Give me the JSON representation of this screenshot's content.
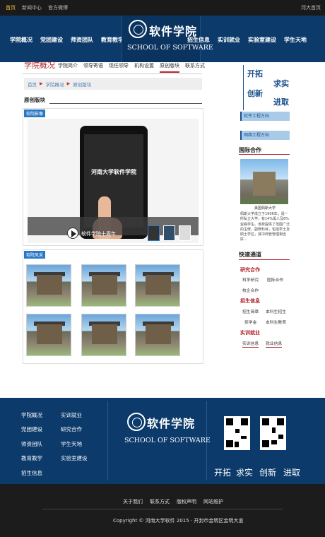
{
  "topbar": {
    "links": [
      "首页",
      "新闻中心",
      "官方微博"
    ],
    "right_link": "河大首页"
  },
  "header": {
    "nav_left": [
      "学院概况",
      "党团建设",
      "师资团队",
      "教育教学"
    ],
    "nav_right": [
      "招生信息",
      "实训就业",
      "实验室建设",
      "学生天地"
    ],
    "logo_cn": "软件学院",
    "logo_en": "SCHOOL OF SOFTWARE"
  },
  "subnav": {
    "section_title": "学院概况",
    "items": [
      "学院简介",
      "领导寄语",
      "现任领导",
      "机构设置",
      "原创版块",
      "联系方式"
    ],
    "active_index": 4
  },
  "breadcrumb": [
    "首页",
    "学院概况",
    "原创版块"
  ],
  "block_title": "原创版块",
  "video_panel": {
    "tag": "软院影像",
    "tablet_title": "河南大学软件学院",
    "caption": "软件学院十周年"
  },
  "photo_panel": {
    "tag": "软院风采"
  },
  "sidebar": {
    "slogan": [
      "开拓",
      "求实",
      "创新",
      "进取"
    ],
    "links": [
      "软件工程方向",
      "网络工程方向"
    ],
    "intl_title": "国际合作",
    "photo_caption": "美国佩斯大学",
    "intl_text": "佩斯大学成立于1906年，是一所私立大学，有14%黑人及8%亚裔学生。该校提供了范围广泛的主修。副修科目，包括学士及硕士学位，其中商管管理相当好...",
    "quick_title": "快速通道",
    "categories": [
      {
        "title": "研究合作",
        "items": [
          "科学研究",
          "国际合作",
          "校企合作"
        ]
      },
      {
        "title": "招生信息",
        "items": [
          "招生简章",
          "本科生招生",
          "奖学金",
          "本科生教育"
        ]
      },
      {
        "title": "实训就业",
        "items": [
          "实训信息",
          "就业信息"
        ]
      }
    ]
  },
  "footer": {
    "col1": [
      "学院概况",
      "党团建设",
      "师资团队",
      "教育教学",
      "招生信息"
    ],
    "col2": [
      "实训就业",
      "研究合作",
      "学生天地",
      "实验室建设"
    ],
    "logo_cn": "软件学院",
    "logo_en": "SCHOOL OF SOFTWARE",
    "slogan": [
      "开拓",
      "求实",
      "创新",
      "进取"
    ]
  },
  "bottombar": {
    "links": [
      "关于我们",
      "联系方式",
      "版权声明",
      "网站维护"
    ],
    "copyright": "Copyright © 河南大学软件 2015 · 开封市金明区金明大道"
  },
  "colors": {
    "brand_blue": "#0b3a6b",
    "accent_red": "#b2262e",
    "tag_blue": "#2a78c5"
  }
}
